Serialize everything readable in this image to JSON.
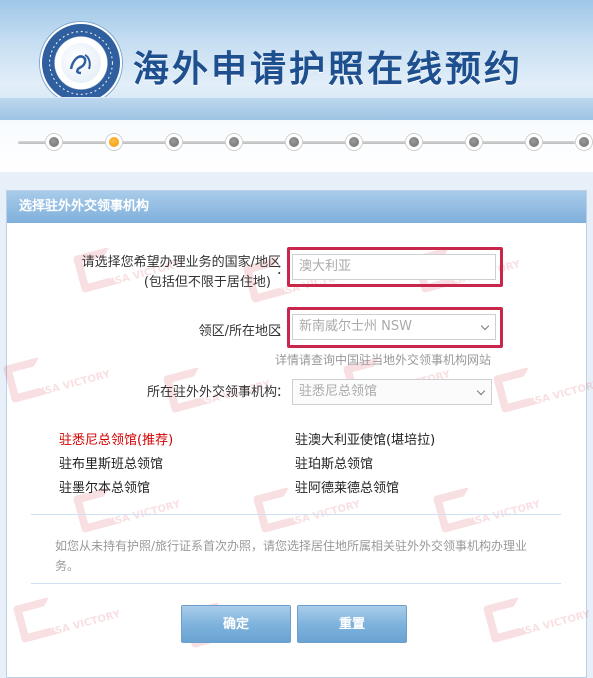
{
  "header": {
    "title": "海外申请护照在线预约",
    "emblem_icon": "consular-affairs-emblem-icon"
  },
  "progress": {
    "steps": 10,
    "current_step": 2
  },
  "panel": {
    "title": "选择驻外外交领事机构",
    "country": {
      "label_line1": "请选择您希望办理业务的国家/地区",
      "label_line2": "(包括但不限于居住地)",
      "colon": "：",
      "value": "澳大利亚"
    },
    "region": {
      "label": "领区/所在地区",
      "colon": "：",
      "value": "新南威尔士州 NSW",
      "hint": "详情请查询中国驻当地外交领事机构网站"
    },
    "mission": {
      "label": "所在驻外外交领事机构",
      "colon": "：",
      "value": "驻悉尼总领馆"
    },
    "consulates": [
      {
        "name": "驻悉尼总领馆(推荐)",
        "recommended": true
      },
      {
        "name": "驻澳大利亚使馆(堪培拉)",
        "recommended": false
      },
      {
        "name": "驻布里斯班总领馆",
        "recommended": false
      },
      {
        "name": "驻珀斯总领馆",
        "recommended": false
      },
      {
        "name": "驻墨尔本总领馆",
        "recommended": false
      },
      {
        "name": "驻阿德莱德总领馆",
        "recommended": false
      }
    ],
    "notice": "如您从未持有护照/旅行证系首次办照，请您选择居住地所属相关驻外外交领事机构办理业务。",
    "confirm_button": "确定",
    "reset_button": "重置"
  },
  "colors": {
    "accent": "#1e4f8f",
    "highlight_border": "#c8264a",
    "recommended_text": "#d40000",
    "button": "#7fb3dd"
  }
}
